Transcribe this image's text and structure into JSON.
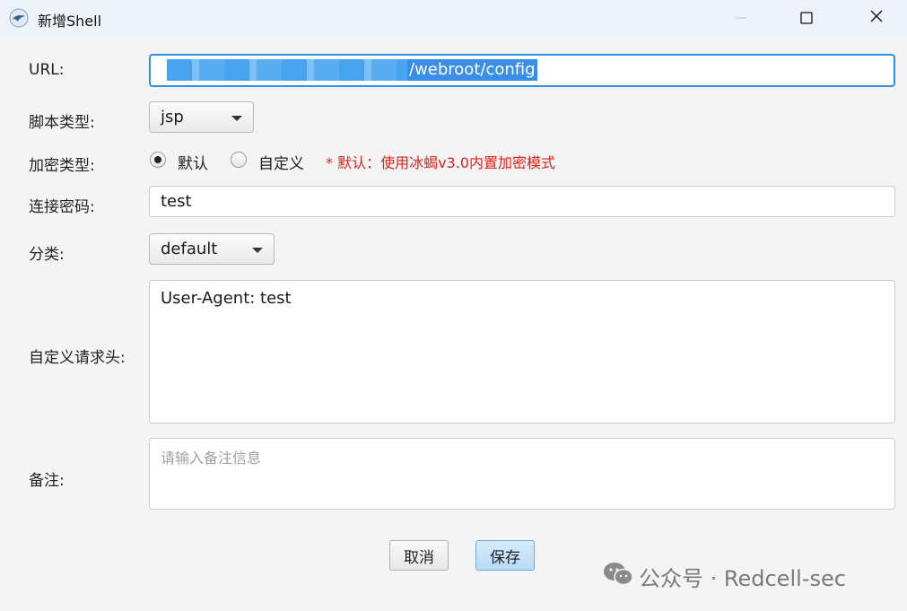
{
  "window": {
    "title": "新增Shell"
  },
  "form": {
    "url_label": "URL:",
    "url_value_visible": "/webroot/config",
    "script_type_label": "脚本类型:",
    "script_type_value": "jsp",
    "encrypt_type_label": "加密类型:",
    "encrypt_options": [
      "默认",
      "自定义"
    ],
    "encrypt_selected": "默认",
    "encrypt_note": "* 默认：使用冰蝎v3.0内置加密模式",
    "password_label": "连接密码:",
    "password_value": "test",
    "category_label": "分类:",
    "category_value": "default",
    "headers_label": "自定义请求头:",
    "headers_value": "User-Agent: test",
    "remark_label": "备注:",
    "remark_placeholder": "请输入备注信息"
  },
  "buttons": {
    "cancel": "取消",
    "save": "保存"
  },
  "watermark": {
    "text": "公众号 · Redcell-sec"
  },
  "colors": {
    "accent": "#2f8fe0",
    "note_red": "#e0201b",
    "save_bg": "#c4e1f7"
  }
}
